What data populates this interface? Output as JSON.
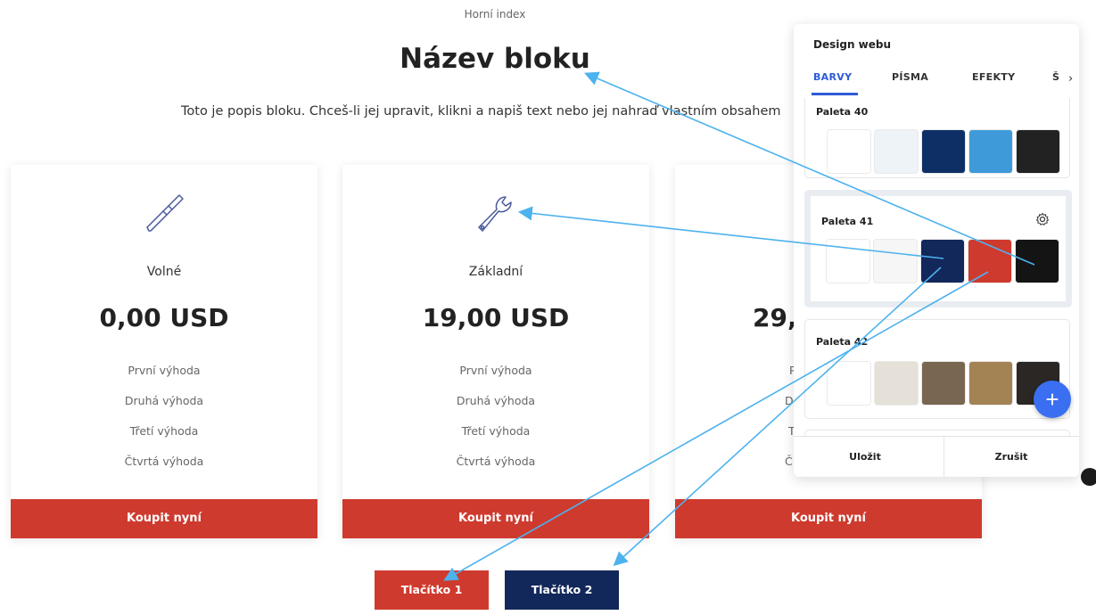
{
  "page": {
    "top_index": "Horní index",
    "block_title": "Název bloku",
    "block_description": "Toto je popis bloku. Chceš-li jej upravit, klikni a napiš text nebo jej nahraď vlastním obsahem"
  },
  "cards": [
    {
      "icon": "screwdriver-icon",
      "name": "Volné",
      "price": "0,00 USD",
      "benefits": [
        "První výhoda",
        "Druhá výhoda",
        "Třetí výhoda",
        "Čtvrtá výhoda"
      ],
      "button": "Koupit nyní"
    },
    {
      "icon": "wrench-icon",
      "name": "Základní",
      "price": "19,00 USD",
      "benefits": [
        "První výhoda",
        "Druhá výhoda",
        "Třetí výhoda",
        "Čtvrtá výhoda"
      ],
      "button": "Koupit nyní"
    },
    {
      "icon": "tool-icon",
      "name": "",
      "price": "29,",
      "benefits": [
        "P",
        "D",
        "T",
        "Č"
      ],
      "button": "Koupit nyní"
    }
  ],
  "buttons": {
    "button1": "Tlačítko 1",
    "button2": "Tlačítko 2"
  },
  "panel": {
    "title": "Design webu",
    "tabs": [
      "BARVY",
      "PÍSMA",
      "EFEKTY",
      "Š"
    ],
    "palettes": [
      {
        "name": "Paleta 40",
        "colors": [
          "#ffffff",
          "#eef3f8",
          "#0d2f66",
          "#3e9ad8",
          "#222222"
        ]
      },
      {
        "name": "Paleta 41",
        "colors": [
          "#ffffff",
          "#f6f6f6",
          "#12275a",
          "#cf3a2e",
          "#141414"
        ]
      },
      {
        "name": "Paleta 42",
        "colors": [
          "#ffffff",
          "#e5e1d8",
          "#786650",
          "#a38353",
          "#2a2724"
        ]
      }
    ],
    "save": "Uložit",
    "cancel": "Zrušit"
  },
  "colors": {
    "accent_blue": "#2f5bd8",
    "button_red": "#cf3a2e",
    "button_navy": "#12275a",
    "arrow": "#4db2ee"
  }
}
